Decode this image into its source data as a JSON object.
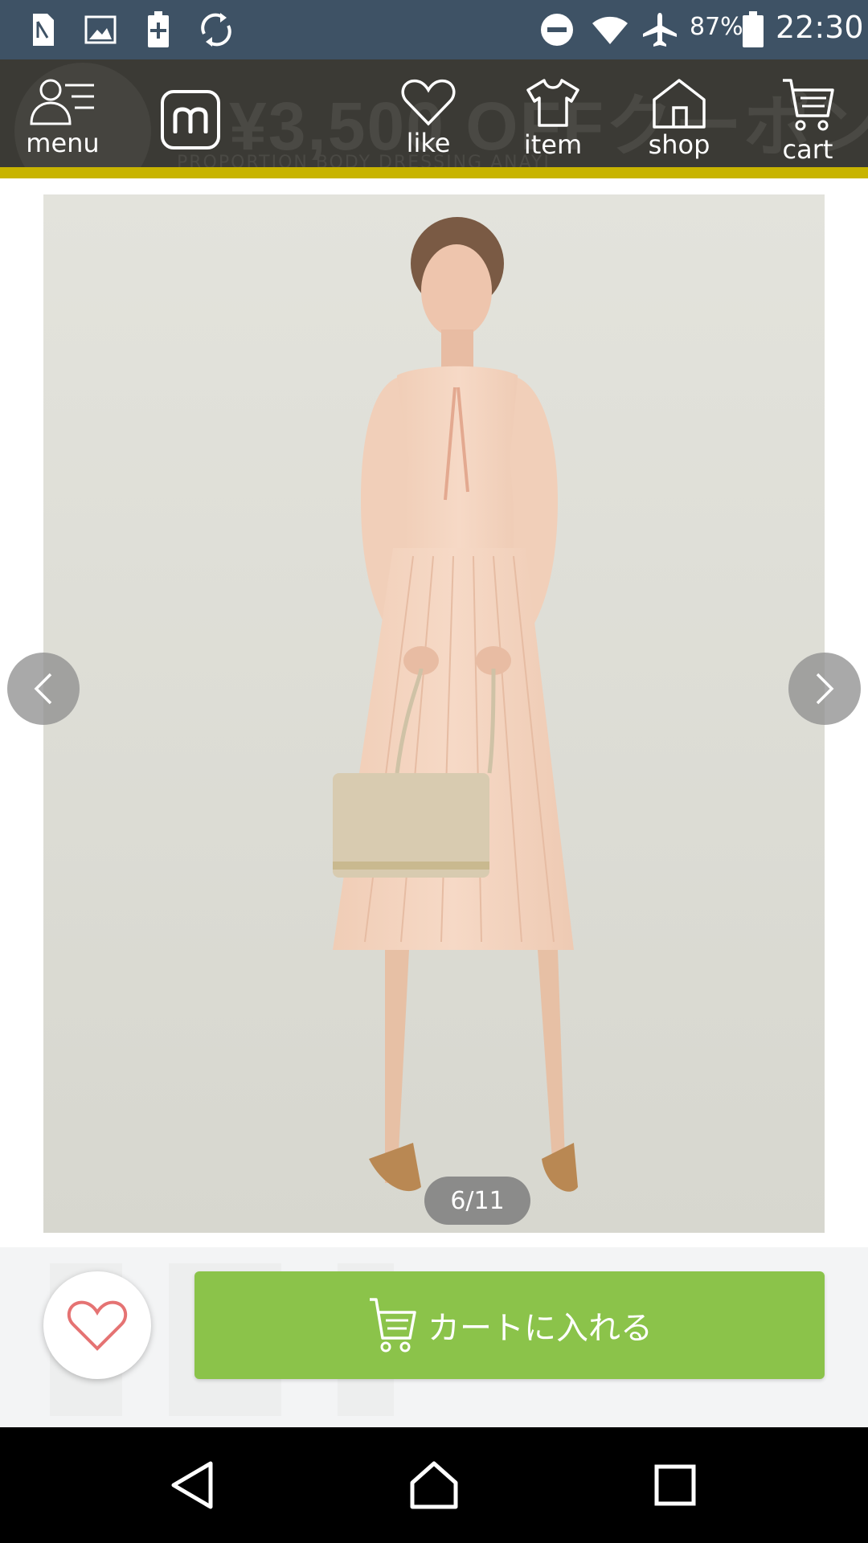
{
  "status_bar": {
    "battery_percent": "87%",
    "time": "22:30",
    "left_icons": [
      "sim-icon",
      "image-icon",
      "battery-saver-icon",
      "sync-icon"
    ],
    "right_icons": [
      "do-not-disturb-icon",
      "wifi-icon",
      "airplane-icon",
      "battery-icon"
    ]
  },
  "nav": {
    "menu_label": "menu",
    "like_label": "like",
    "item_label": "item",
    "shop_label": "shop",
    "cart_label": "cart",
    "logo_icon": "logo-m-icon",
    "banner_ghost_price": "¥3,500 OFFクーポン!",
    "banner_ghost_sub": "PROPORTION BODY DRESSING ANAYI",
    "accent_color": "#c8b400"
  },
  "product": {
    "page_indicator": "6/11",
    "prev_icon": "chevron-left-icon",
    "next_icon": "chevron-right-icon",
    "photo_subject": "product-photo"
  },
  "actions": {
    "cart_button_label": "カートに入れる",
    "cart_button_color": "#8bc34a",
    "like_icon": "heart-outline-icon",
    "like_color": "#e57373"
  },
  "android_nav": {
    "back_icon": "back-triangle-icon",
    "home_icon": "home-icon",
    "recents_icon": "recents-square-icon"
  }
}
